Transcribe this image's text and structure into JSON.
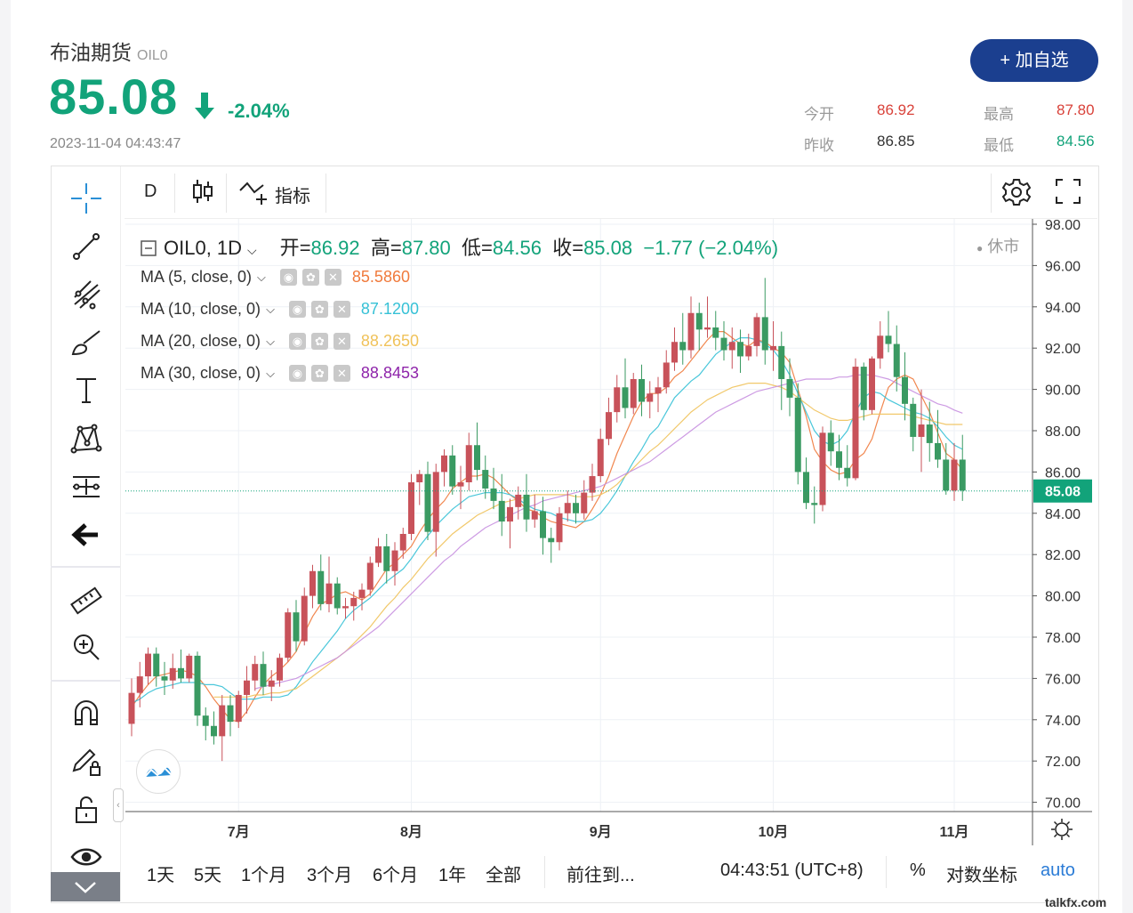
{
  "header": {
    "title": "布油期货",
    "code": "OIL0",
    "price": "85.08",
    "change_pct": "-2.04%",
    "timestamp": "2023-11-04 04:43:47",
    "add_button": "+ 加自选",
    "stats": {
      "open_label": "今开",
      "open": "86.92",
      "high_label": "最高",
      "high": "87.80",
      "prev_label": "昨收",
      "prev": "86.85",
      "low_label": "最低",
      "low": "84.56"
    }
  },
  "toolbar": {
    "interval": "D",
    "indicators": "指标"
  },
  "legend": {
    "symbol": "OIL0, 1D",
    "open_label": "开",
    "open": "86.92",
    "high_label": "高",
    "high": "87.80",
    "low_label": "低",
    "low": "84.56",
    "close_label": "收",
    "close": "85.08",
    "change": "−1.77 (−2.04%)",
    "market_status": "休市",
    "ma": [
      {
        "label": "MA (5, close, 0)",
        "value": "85.5860",
        "color": "#f07a3c"
      },
      {
        "label": "MA (10, close, 0)",
        "value": "87.1200",
        "color": "#36c1d6"
      },
      {
        "label": "MA (20, close, 0)",
        "value": "88.2650",
        "color": "#f0c25a"
      },
      {
        "label": "MA (30, close, 0)",
        "value": "88.8453",
        "color": "#8e24aa"
      }
    ]
  },
  "bottom": {
    "ranges": [
      "1天",
      "5天",
      "1个月",
      "3个月",
      "6个月",
      "1年",
      "全部"
    ],
    "goto": "前往到...",
    "clock": "04:43:51 (UTC+8)",
    "percent": "%",
    "log": "对数坐标",
    "auto": "auto"
  },
  "watermark": "talkfx.com",
  "colors": {
    "up": "#c8525a",
    "down": "#3a9a62",
    "price_line": "#12a37a"
  },
  "chart_data": {
    "type": "candlestick",
    "ylim": [
      69.5,
      98.5
    ],
    "y_ticks": [
      "98.00",
      "96.00",
      "94.00",
      "92.00",
      "90.00",
      "88.00",
      "86.00",
      "84.00",
      "82.00",
      "80.00",
      "78.00",
      "76.00",
      "74.00",
      "72.00",
      "70.00"
    ],
    "x_ticks": [
      {
        "label": "7月",
        "index": 13
      },
      {
        "label": "8月",
        "index": 34
      },
      {
        "label": "9月",
        "index": 57
      },
      {
        "label": "10月",
        "index": 78
      },
      {
        "label": "11月",
        "index": 100
      }
    ],
    "last_price_label": "85.08",
    "candles": [
      [
        73.8,
        76.0,
        73.2,
        75.3
      ],
      [
        75.3,
        76.8,
        74.6,
        76.1
      ],
      [
        76.1,
        77.5,
        75.7,
        77.2
      ],
      [
        77.2,
        77.5,
        75.6,
        76.1
      ],
      [
        76.1,
        76.8,
        75.2,
        75.9
      ],
      [
        75.9,
        77.2,
        75.5,
        76.5
      ],
      [
        76.5,
        77.4,
        75.8,
        76.0
      ],
      [
        76.0,
        77.2,
        75.8,
        77.1
      ],
      [
        77.1,
        77.3,
        73.7,
        74.2
      ],
      [
        74.2,
        74.6,
        73.0,
        73.7
      ],
      [
        73.7,
        74.4,
        72.8,
        73.2
      ],
      [
        73.2,
        75.2,
        72.0,
        74.7
      ],
      [
        74.7,
        75.2,
        73.2,
        73.9
      ],
      [
        73.9,
        75.4,
        73.6,
        75.2
      ],
      [
        75.2,
        76.6,
        74.3,
        75.9
      ],
      [
        75.9,
        77.1,
        75.4,
        76.7
      ],
      [
        76.7,
        77.3,
        75.2,
        75.6
      ],
      [
        75.6,
        76.4,
        74.9,
        75.9
      ],
      [
        75.9,
        77.2,
        75.6,
        77.0
      ],
      [
        77.0,
        79.4,
        76.8,
        79.2
      ],
      [
        79.2,
        79.8,
        77.3,
        77.8
      ],
      [
        77.8,
        80.4,
        77.6,
        80.0
      ],
      [
        80.0,
        81.5,
        79.4,
        81.2
      ],
      [
        81.2,
        82.0,
        79.3,
        79.6
      ],
      [
        79.6,
        81.9,
        79.2,
        80.6
      ],
      [
        80.6,
        80.9,
        79.1,
        79.4
      ],
      [
        79.4,
        79.9,
        78.9,
        79.5
      ],
      [
        79.5,
        80.2,
        78.8,
        79.9
      ],
      [
        79.9,
        80.6,
        79.3,
        80.3
      ],
      [
        80.3,
        81.9,
        80.0,
        81.6
      ],
      [
        81.6,
        82.8,
        81.4,
        82.4
      ],
      [
        82.4,
        83.0,
        80.6,
        81.2
      ],
      [
        81.2,
        82.6,
        80.5,
        82.2
      ],
      [
        82.2,
        83.3,
        81.8,
        83.0
      ],
      [
        83.0,
        85.9,
        82.7,
        85.5
      ],
      [
        85.5,
        86.1,
        84.4,
        85.9
      ],
      [
        85.9,
        86.5,
        82.7,
        83.1
      ],
      [
        83.1,
        86.4,
        81.9,
        86.0
      ],
      [
        86.0,
        87.1,
        85.3,
        86.8
      ],
      [
        86.8,
        87.3,
        84.9,
        85.3
      ],
      [
        85.3,
        86.3,
        84.2,
        85.5
      ],
      [
        85.5,
        87.9,
        85.1,
        87.3
      ],
      [
        87.3,
        88.4,
        85.6,
        86.1
      ],
      [
        86.1,
        86.8,
        84.7,
        85.2
      ],
      [
        85.2,
        86.2,
        84.2,
        84.6
      ],
      [
        84.6,
        85.9,
        82.9,
        83.6
      ],
      [
        83.6,
        84.7,
        82.3,
        84.3
      ],
      [
        84.3,
        85.3,
        83.7,
        84.9
      ],
      [
        84.9,
        85.9,
        83.1,
        83.7
      ],
      [
        83.7,
        84.9,
        83.3,
        84.1
      ],
      [
        84.1,
        84.8,
        82.0,
        82.8
      ],
      [
        82.8,
        83.3,
        81.6,
        82.6
      ],
      [
        82.6,
        84.3,
        82.2,
        84.0
      ],
      [
        84.0,
        85.1,
        83.6,
        84.5
      ],
      [
        84.5,
        84.9,
        83.5,
        84.0
      ],
      [
        84.0,
        85.6,
        83.7,
        85.0
      ],
      [
        85.0,
        86.4,
        84.6,
        85.8
      ],
      [
        85.8,
        88.1,
        85.5,
        87.6
      ],
      [
        87.6,
        89.6,
        87.3,
        88.9
      ],
      [
        88.9,
        90.7,
        88.4,
        90.1
      ],
      [
        90.1,
        91.5,
        88.6,
        89.1
      ],
      [
        89.1,
        90.8,
        88.8,
        90.5
      ],
      [
        90.5,
        91.2,
        88.7,
        89.4
      ],
      [
        89.4,
        90.4,
        88.6,
        89.8
      ],
      [
        89.8,
        90.6,
        88.9,
        90.1
      ],
      [
        90.1,
        91.9,
        89.8,
        91.3
      ],
      [
        91.3,
        93.0,
        90.9,
        92.3
      ],
      [
        92.3,
        93.7,
        91.2,
        91.9
      ],
      [
        91.9,
        94.5,
        91.5,
        93.7
      ],
      [
        93.7,
        94.2,
        91.9,
        92.9
      ],
      [
        92.9,
        94.5,
        92.5,
        93.0
      ],
      [
        93.0,
        93.8,
        91.9,
        92.5
      ],
      [
        92.5,
        93.3,
        91.4,
        91.9
      ],
      [
        91.9,
        93.0,
        91.0,
        92.3
      ],
      [
        92.3,
        92.9,
        90.8,
        91.6
      ],
      [
        91.6,
        92.7,
        91.4,
        92.1
      ],
      [
        92.1,
        93.7,
        91.6,
        93.5
      ],
      [
        93.5,
        95.4,
        91.2,
        91.9
      ],
      [
        91.9,
        93.3,
        90.9,
        92.1
      ],
      [
        92.1,
        92.8,
        89.0,
        90.5
      ],
      [
        90.5,
        91.5,
        88.7,
        89.6
      ],
      [
        89.6,
        90.3,
        85.4,
        86.0
      ],
      [
        86.0,
        86.7,
        84.2,
        84.5
      ],
      [
        84.5,
        85.3,
        83.5,
        84.4
      ],
      [
        84.4,
        88.2,
        84.1,
        87.9
      ],
      [
        87.9,
        88.5,
        86.3,
        87.0
      ],
      [
        87.0,
        87.8,
        85.6,
        86.2
      ],
      [
        86.2,
        87.3,
        85.3,
        85.7
      ],
      [
        85.7,
        91.5,
        85.6,
        91.1
      ],
      [
        91.1,
        91.3,
        88.5,
        89.0
      ],
      [
        89.0,
        91.6,
        88.8,
        91.5
      ],
      [
        91.5,
        93.3,
        91.0,
        92.6
      ],
      [
        92.6,
        93.8,
        91.8,
        92.2
      ],
      [
        92.2,
        93.1,
        89.9,
        90.6
      ],
      [
        90.6,
        91.8,
        88.5,
        89.3
      ],
      [
        89.3,
        89.6,
        87.0,
        87.7
      ],
      [
        87.7,
        90.0,
        86.0,
        88.3
      ],
      [
        88.3,
        89.4,
        86.5,
        87.4
      ],
      [
        87.4,
        89.0,
        86.2,
        86.6
      ],
      [
        86.6,
        87.4,
        84.9,
        85.1
      ],
      [
        85.1,
        87.4,
        84.6,
        86.6
      ],
      [
        86.6,
        87.8,
        84.6,
        85.1
      ]
    ],
    "ma": {
      "MA5": {
        "color": "#f07a3c",
        "values": [
          74.6,
          75.2,
          75.7,
          76.1,
          76.2,
          76.3,
          76.4,
          76.3,
          76.1,
          75.6,
          75.0,
          74.5,
          74.0,
          73.9,
          74.4,
          75.1,
          75.7,
          76.1,
          76.4,
          76.8,
          77.3,
          78.2,
          79.0,
          79.6,
          79.8,
          80.1,
          80.2,
          80.0,
          79.8,
          80.1,
          80.7,
          81.3,
          81.6,
          82.0,
          82.4,
          83.1,
          83.7,
          84.2,
          84.6,
          85.2,
          85.5,
          85.8,
          85.8,
          85.9,
          85.7,
          85.3,
          84.9,
          84.6,
          84.2,
          84.1,
          83.8,
          83.6,
          83.5,
          83.4,
          83.3,
          83.6,
          84.2,
          84.9,
          85.8,
          86.9,
          87.8,
          88.7,
          89.4,
          89.8,
          89.8,
          90.1,
          90.6,
          90.9,
          91.4,
          91.9,
          92.4,
          92.8,
          92.8,
          92.5,
          92.2,
          92.1,
          92.4,
          92.3,
          92.0,
          91.8,
          91.3,
          90.0,
          88.7,
          87.1,
          86.5,
          86.1,
          85.9,
          86.0,
          86.6,
          86.9,
          87.6,
          88.9,
          90.1,
          90.5,
          90.7,
          90.5,
          89.7,
          88.9,
          87.9,
          86.9,
          86.6,
          86.1
        ]
      },
      "MA10": {
        "color": "#36c1d6",
        "values": [
          74.8,
          75.0,
          75.3,
          75.5,
          75.6,
          75.7,
          75.8,
          75.8,
          75.8,
          75.7,
          75.7,
          75.6,
          75.3,
          75.0,
          75.0,
          75.0,
          75.1,
          75.1,
          75.1,
          75.2,
          75.6,
          76.2,
          76.8,
          77.3,
          77.8,
          78.3,
          78.9,
          79.3,
          79.6,
          79.9,
          80.3,
          80.7,
          81.0,
          81.3,
          81.8,
          82.4,
          82.9,
          83.4,
          83.8,
          84.2,
          84.5,
          84.8,
          84.9,
          85.0,
          85.0,
          85.0,
          84.9,
          84.7,
          84.4,
          84.2,
          84.1,
          84.0,
          83.8,
          83.7,
          83.6,
          83.6,
          83.7,
          84.0,
          84.5,
          85.1,
          85.8,
          86.5,
          87.1,
          87.8,
          88.2,
          88.9,
          89.6,
          90.0,
          90.4,
          90.7,
          91.2,
          91.7,
          92.0,
          92.3,
          92.5,
          92.5,
          92.4,
          92.2,
          91.9,
          91.4,
          90.7,
          89.8,
          88.9,
          88.0,
          87.5,
          87.3,
          87.5,
          88.0,
          88.9,
          89.6,
          89.9,
          89.8,
          89.5,
          89.3,
          89.1,
          88.9,
          88.8,
          88.6,
          88.2,
          87.7,
          87.3,
          87.1
        ]
      },
      "MA20": {
        "color": "#f0c25a",
        "values": [
          null,
          null,
          null,
          null,
          null,
          null,
          null,
          null,
          null,
          null,
          75.1,
          75.1,
          75.1,
          75.1,
          75.1,
          75.2,
          75.2,
          75.3,
          75.3,
          75.4,
          75.5,
          75.8,
          76.1,
          76.4,
          76.7,
          77.0,
          77.3,
          77.7,
          78.1,
          78.5,
          79.0,
          79.5,
          79.9,
          80.4,
          80.8,
          81.3,
          81.8,
          82.2,
          82.6,
          83.0,
          83.3,
          83.6,
          83.9,
          84.1,
          84.3,
          84.5,
          84.6,
          84.7,
          84.8,
          84.9,
          84.9,
          84.9,
          84.9,
          84.9,
          84.8,
          84.8,
          84.8,
          84.9,
          85.1,
          85.4,
          85.8,
          86.2,
          86.6,
          87.0,
          87.3,
          87.7,
          88.1,
          88.5,
          88.9,
          89.2,
          89.5,
          89.7,
          89.9,
          90.1,
          90.2,
          90.3,
          90.3,
          90.3,
          90.2,
          90.1,
          89.9,
          89.6,
          89.3,
          89.0,
          88.8,
          88.6,
          88.5,
          88.5,
          88.6,
          88.7,
          88.8,
          88.8,
          88.8,
          88.8,
          88.8,
          88.7,
          88.6,
          88.5,
          88.4,
          88.3,
          88.3,
          88.3
        ]
      },
      "MA30": {
        "color": "#c890e0",
        "values": [
          null,
          null,
          null,
          null,
          null,
          null,
          null,
          null,
          null,
          null,
          null,
          null,
          null,
          null,
          null,
          75.5,
          75.6,
          75.7,
          75.8,
          75.9,
          76.0,
          76.2,
          76.4,
          76.6,
          76.8,
          77.0,
          77.3,
          77.6,
          77.9,
          78.2,
          78.5,
          78.9,
          79.3,
          79.7,
          80.1,
          80.5,
          80.9,
          81.3,
          81.7,
          82.0,
          82.4,
          82.7,
          83.0,
          83.3,
          83.5,
          83.7,
          83.9,
          84.1,
          84.3,
          84.4,
          84.6,
          84.7,
          84.8,
          84.9,
          85.0,
          85.1,
          85.2,
          85.3,
          85.5,
          85.7,
          85.9,
          86.1,
          86.3,
          86.5,
          86.8,
          87.1,
          87.4,
          87.7,
          88.0,
          88.3,
          88.6,
          88.9,
          89.1,
          89.3,
          89.5,
          89.7,
          89.9,
          90.0,
          90.1,
          90.2,
          90.3,
          90.4,
          90.5,
          90.5,
          90.5,
          90.5,
          90.6,
          90.6,
          90.7,
          90.7,
          90.7,
          90.6,
          90.5,
          90.3,
          90.1,
          89.9,
          89.7,
          89.5,
          89.3,
          89.2,
          89.0,
          88.85
        ]
      }
    }
  }
}
